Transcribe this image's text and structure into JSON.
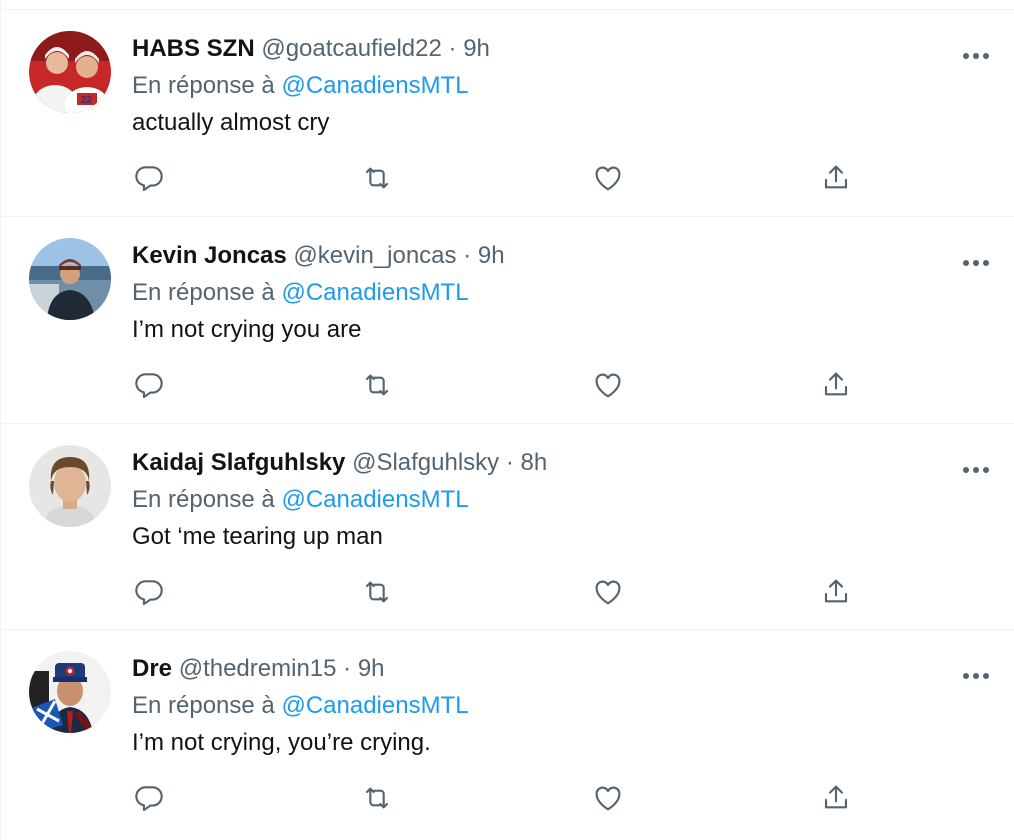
{
  "tweets": [
    {
      "name": "HABS SZN",
      "handle": "@goatcaufield22",
      "separator": "·",
      "time": "9h",
      "reply_prefix": "En réponse à",
      "reply_mention": "@CanadiensMTL",
      "text": "actually almost cry",
      "avatar_icon": "hockey-players-avatar"
    },
    {
      "name": "Kevin Joncas",
      "handle": "@kevin_joncas",
      "separator": "·",
      "time": "9h",
      "reply_prefix": "En réponse à",
      "reply_mention": "@CanadiensMTL",
      "text": "I’m not crying you are",
      "avatar_icon": "person-by-water-avatar"
    },
    {
      "name": "Kaidaj Slafguhlsky",
      "handle": "@Slafguhlsky",
      "separator": "·",
      "time": "8h",
      "reply_prefix": "En réponse à",
      "reply_mention": "@CanadiensMTL",
      "text": "Got ‘me tearing up man",
      "avatar_icon": "young-man-portrait-avatar"
    },
    {
      "name": "Dre",
      "handle": "@thedremin15",
      "separator": "·",
      "time": "9h",
      "reply_prefix": "En réponse à",
      "reply_mention": "@CanadiensMTL",
      "text": "I’m not crying, you’re crying.",
      "avatar_icon": "man-with-flag-avatar"
    }
  ],
  "icons": {
    "more": "more-icon",
    "reply": "reply-icon",
    "retweet": "retweet-icon",
    "like": "like-icon",
    "share": "share-icon"
  },
  "colors": {
    "text": "#0f1419",
    "secondary": "#536471",
    "link": "#1d9bf0",
    "divider": "#eff3f4"
  }
}
